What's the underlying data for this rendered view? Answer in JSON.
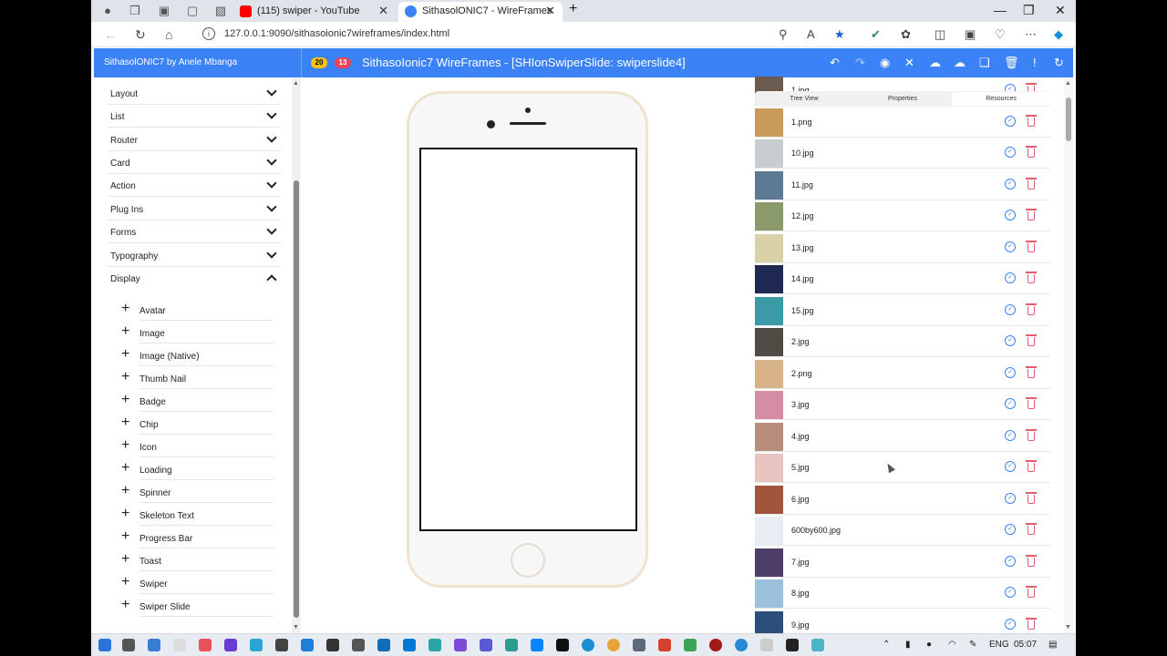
{
  "browser": {
    "tabs": [
      {
        "label": "(115) swiper - YouTube",
        "favicon_color": "#ff0000"
      },
      {
        "label": "SithasolONIC7 - WireFrames",
        "favicon_color": "#3b82f6"
      }
    ],
    "url": "127.0.0.1:9090/sithasoionic7wireframes/index.html"
  },
  "app": {
    "brand": "SithasolONIC7 by Anele Mbanga",
    "badges": [
      {
        "value": "20",
        "color": "#ffc409",
        "text_color": "#000000"
      },
      {
        "value": "13",
        "color": "#eb445a",
        "text_color": "#ffffff"
      }
    ],
    "title": "SithasoIonic7 WireFrames - [SHIonSwiperSlide: swiperslide4]",
    "header_icons": [
      "undo-icon",
      "redo-icon",
      "camera-icon",
      "tools-icon",
      "cloud-download-icon",
      "cloud-upload-icon",
      "copy-icon",
      "trash-icon",
      "alert-icon",
      "refresh-icon"
    ],
    "accent": "#3b82f6"
  },
  "sidebar": {
    "groups": [
      {
        "label": "Layout",
        "expanded": false
      },
      {
        "label": "List",
        "expanded": false
      },
      {
        "label": "Router",
        "expanded": false
      },
      {
        "label": "Card",
        "expanded": false
      },
      {
        "label": "Action",
        "expanded": false
      },
      {
        "label": "Plug Ins",
        "expanded": false
      },
      {
        "label": "Forms",
        "expanded": false
      },
      {
        "label": "Typography",
        "expanded": false
      },
      {
        "label": "Display",
        "expanded": true
      }
    ],
    "display_items": [
      "Avatar",
      "Image",
      "Image (Native)",
      "Thumb Nail",
      "Badge",
      "Chip",
      "Icon",
      "Loading",
      "Spinner",
      "Skeleton Text",
      "Progress Bar",
      "Toast",
      "Swiper",
      "Swiper Slide"
    ]
  },
  "right_panel": {
    "tabs": [
      "Tree View",
      "Properties",
      "Resources"
    ],
    "active_tab": "Resources",
    "resources": [
      {
        "name": "1.jpg",
        "color": "#6b5a4e"
      },
      {
        "name": "1.png",
        "color": "#c99b5a"
      },
      {
        "name": "10.jpg",
        "color": "#c9ccd1"
      },
      {
        "name": "11.jpg",
        "color": "#5d7a94"
      },
      {
        "name": "12.jpg",
        "color": "#8a9a6a"
      },
      {
        "name": "13.jpg",
        "color": "#d9d2a8"
      },
      {
        "name": "14.jpg",
        "color": "#1f2a52"
      },
      {
        "name": "15.jpg",
        "color": "#3c9aa6"
      },
      {
        "name": "2.jpg",
        "color": "#4e4a44"
      },
      {
        "name": "2.png",
        "color": "#d8b38a"
      },
      {
        "name": "3.jpg",
        "color": "#d58da3"
      },
      {
        "name": "4.jpg",
        "color": "#b98d7d"
      },
      {
        "name": "5.jpg",
        "color": "#e9c4c0"
      },
      {
        "name": "6.jpg",
        "color": "#a2553e"
      },
      {
        "name": "600by600.jpg",
        "color": "#e8ecf3"
      },
      {
        "name": "7.jpg",
        "color": "#4e3f6a"
      },
      {
        "name": "8.jpg",
        "color": "#9cc1dc"
      },
      {
        "name": "9.jpg",
        "color": "#2b4f7a"
      }
    ]
  },
  "taskbar": {
    "lang": "ENG",
    "time": "05:07"
  }
}
